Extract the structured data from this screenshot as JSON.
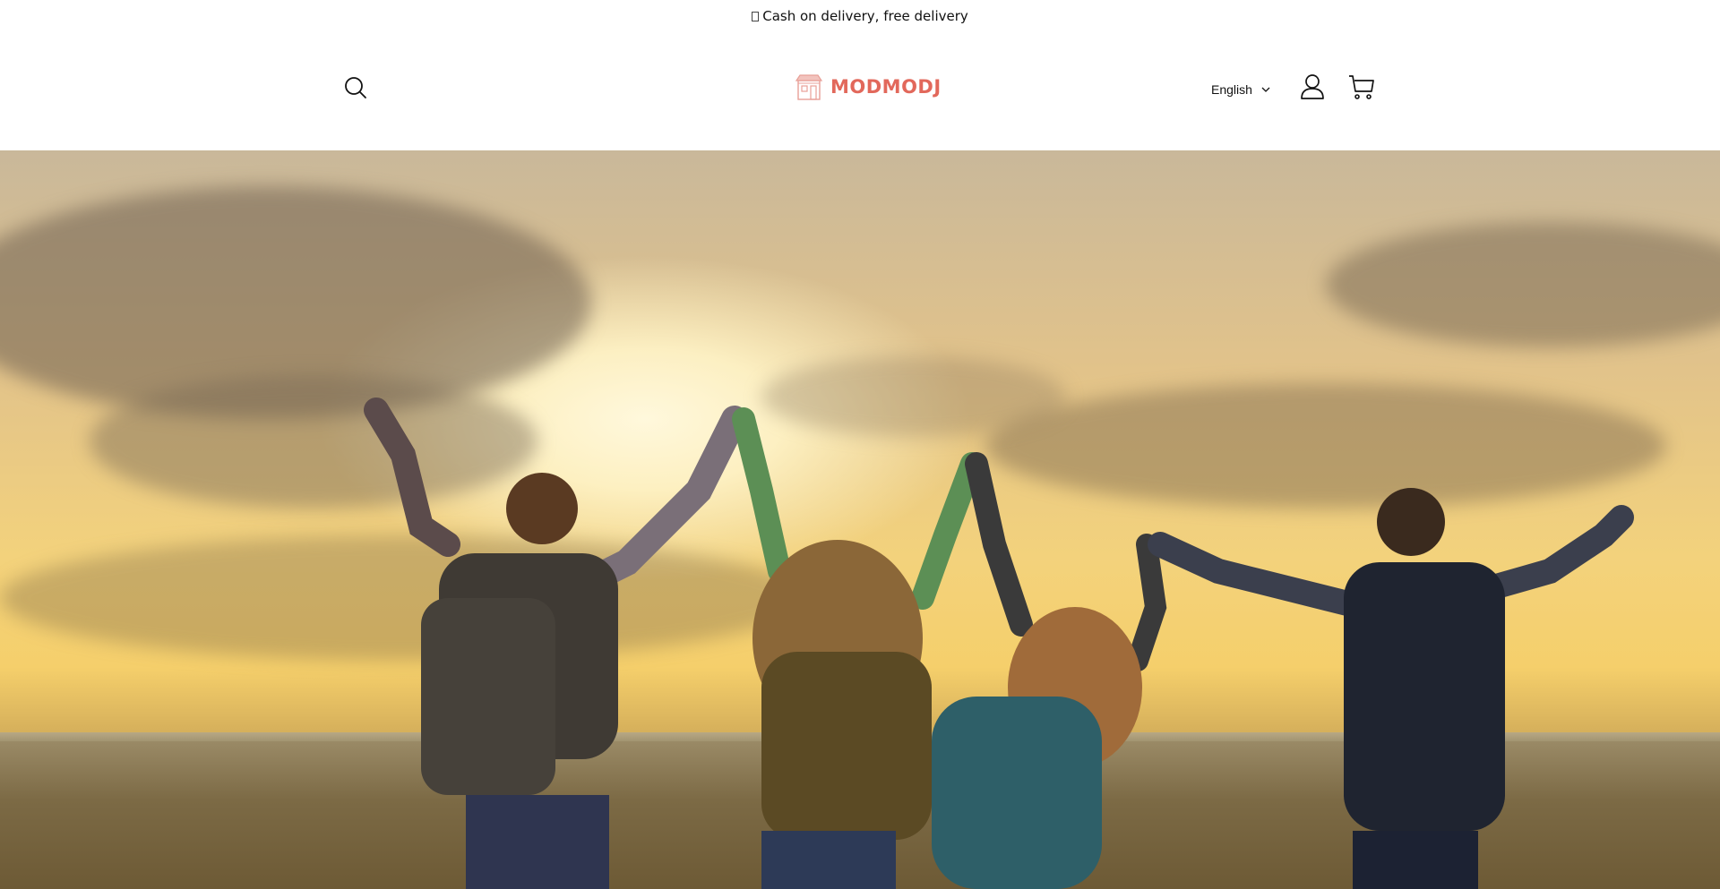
{
  "announcement": {
    "text": "Cash on delivery, free delivery",
    "icon": "unknown-glyph-icon"
  },
  "header": {
    "search_icon": "search-icon",
    "logo": {
      "text": "MODMODJ",
      "icon": "storefront-icon",
      "color": "#e2685b"
    },
    "language": {
      "selected": "English",
      "icon": "chevron-down-icon"
    },
    "account_icon": "account-icon",
    "cart_icon": "cart-icon"
  },
  "hero": {
    "image": "group-of-hikers-holding-hands-at-sunset-photo"
  },
  "colors": {
    "brand": "#e2685b",
    "text": "#121212",
    "background": "#ffffff"
  }
}
